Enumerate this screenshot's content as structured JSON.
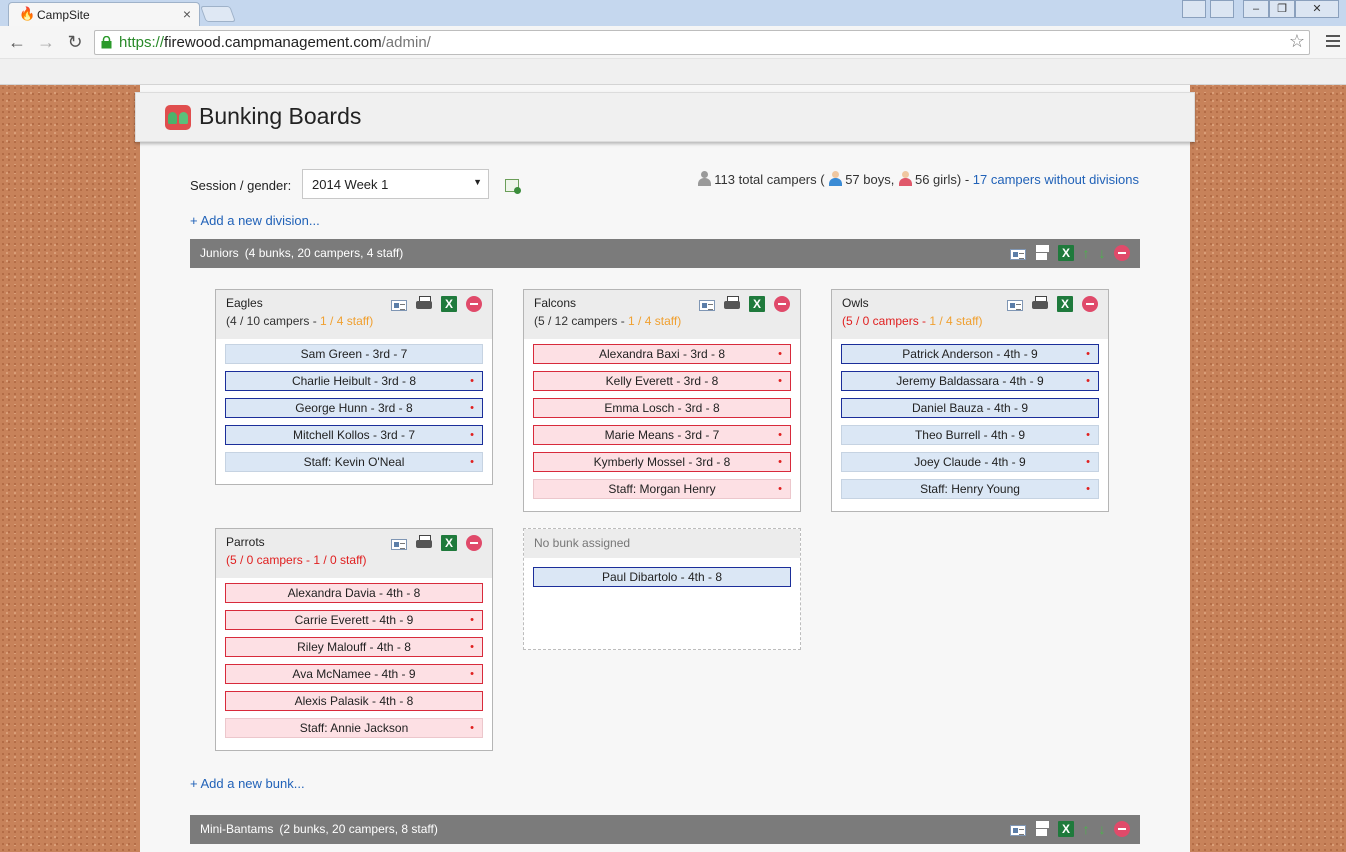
{
  "browser": {
    "tab_title": "CampSite",
    "tab_close": "×",
    "url_scheme": "https://",
    "url_host": "firewood.campmanagement.com",
    "url_path": "/admin/",
    "back": "←",
    "forward": "→",
    "reload": "↻",
    "star": "☆",
    "win_min": "–",
    "win_max": "❐",
    "win_close": "✕"
  },
  "header": {
    "title": "Bunking Boards"
  },
  "controls": {
    "session_label": "Session / gender:",
    "session_value": "2014 Week 1",
    "session_arrow": "▼",
    "add_division": "+ Add a new division...",
    "add_bunk": "+ Add a new bunk..."
  },
  "stats": {
    "total": "113 total campers (",
    "boys": "57 boys,",
    "girls": "56 girls) -",
    "without_divisions": "17 campers without divisions"
  },
  "divisions": [
    {
      "name": "Juniors",
      "info": "(4 bunks, 20 campers, 4 staff)"
    },
    {
      "name": "Mini-Bantams",
      "info": "(2 bunks, 20 campers, 8 staff)"
    }
  ],
  "icons": {
    "xls": "X",
    "up": "↑",
    "down": "↓"
  },
  "bunks": [
    {
      "name": "Eagles",
      "campers_count": "(4 / 10 campers -",
      "staff_count": "1 / 4 staff)",
      "members": [
        {
          "label": "Sam Green - 3rd - 7",
          "dot": ""
        },
        {
          "label": "Charlie Heibult - 3rd - 8",
          "dot": "•"
        },
        {
          "label": "George Hunn - 3rd - 8",
          "dot": "•"
        },
        {
          "label": "Mitchell Kollos - 3rd - 7",
          "dot": "•"
        },
        {
          "label": "Staff: Kevin O'Neal",
          "dot": "•"
        }
      ]
    },
    {
      "name": "Falcons",
      "campers_count": "(5 / 12 campers -",
      "staff_count": "1 / 4 staff)",
      "members": [
        {
          "label": "Alexandra Baxi - 3rd - 8",
          "dot": "•"
        },
        {
          "label": "Kelly Everett - 3rd - 8",
          "dot": "•"
        },
        {
          "label": "Emma Losch - 3rd - 8",
          "dot": ""
        },
        {
          "label": "Marie Means - 3rd - 7",
          "dot": "•"
        },
        {
          "label": "Kymberly Mossel - 3rd - 8",
          "dot": "•"
        },
        {
          "label": "Staff: Morgan Henry",
          "dot": "•"
        }
      ]
    },
    {
      "name": "Owls",
      "campers_count": "(5 / 0 campers -",
      "staff_count": "1 / 4 staff)",
      "members": [
        {
          "label": "Patrick Anderson - 4th - 9",
          "dot": "•"
        },
        {
          "label": "Jeremy Baldassara - 4th - 9",
          "dot": "•"
        },
        {
          "label": "Daniel Bauza - 4th - 9",
          "dot": ""
        },
        {
          "label": "Theo Burrell - 4th - 9",
          "dot": "•"
        },
        {
          "label": "Joey Claude - 4th - 9",
          "dot": "•"
        },
        {
          "label": "Staff: Henry Young",
          "dot": "•"
        }
      ]
    },
    {
      "name": "Parrots",
      "campers_count": "(5 / 0 campers -",
      "staff_count": "1 / 0 staff)",
      "members": [
        {
          "label": "Alexandra Davia - 4th - 8",
          "dot": ""
        },
        {
          "label": "Carrie Everett - 4th - 9",
          "dot": "•"
        },
        {
          "label": "Riley Malouff - 4th - 8",
          "dot": "•"
        },
        {
          "label": "Ava McNamee - 4th - 9",
          "dot": "•"
        },
        {
          "label": "Alexis Palasik - 4th - 8",
          "dot": ""
        },
        {
          "label": "Staff: Annie Jackson",
          "dot": "•"
        }
      ]
    }
  ],
  "unassigned": {
    "label": "No bunk assigned",
    "members": [
      {
        "label": "Paul Dibartolo - 4th - 8"
      }
    ]
  },
  "colors": {
    "cork": "#c7825a",
    "division_bar": "#7b7b7b",
    "boy_fill": "#dbe7f5",
    "boy_border": "#1b2e9a",
    "girl_fill": "#fde0e4",
    "girl_border": "#d82a3b",
    "link": "#2162b8",
    "over_capacity": "#e02020",
    "staff_count": "#f0a030"
  }
}
